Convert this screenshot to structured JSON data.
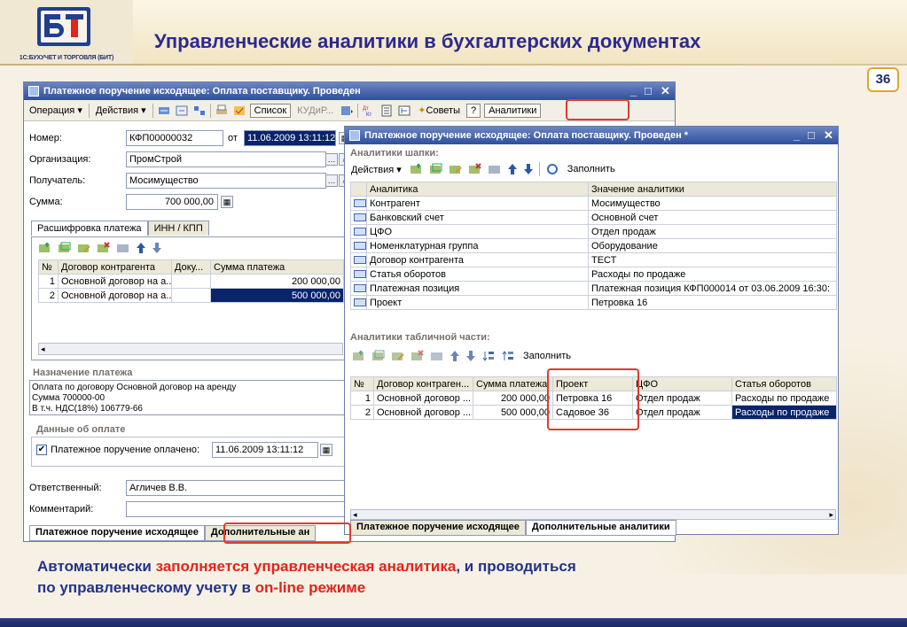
{
  "header": {
    "logo_caption": "1С:БУХУЧЕТ И ТОРГОВЛЯ (БИТ)",
    "title": "Управленческие аналитики в бухгалтерских документах",
    "page_number": "36"
  },
  "win1": {
    "title": "Платежное поручение исходящее: Оплата поставщику. Проведен",
    "toolbar": {
      "operation": "Операция ▾",
      "actions": "Действия ▾",
      "list": "Список",
      "kud": "КУДиР...",
      "advice": "Советы",
      "help": "?",
      "analytics": "Аналитики"
    },
    "form": {
      "number_label": "Номер:",
      "number_value": "КФП00000032",
      "from_label": "от",
      "date_value": "11.06.2009 13:11:12",
      "org_label": "Организация:",
      "org_value": "ПромСтрой",
      "recipient_label": "Получатель:",
      "recipient_value": "Мосимущество",
      "sum_label": "Сумма:",
      "sum_value": "700 000,00"
    },
    "tabs": [
      "Расшифровка платежа",
      "ИНН / КПП"
    ],
    "table": {
      "headers": [
        "№",
        "Договор контрагента",
        "Доку...",
        "Сумма платежа"
      ],
      "rows": [
        {
          "n": "1",
          "contract": "Основной договор на а...",
          "doc": "",
          "sum": "200 000,00"
        },
        {
          "n": "2",
          "contract": "Основной договор на а...",
          "doc": "",
          "sum": "500 000,00"
        }
      ]
    },
    "purpose_title": "Назначение платежа",
    "purpose_lines": [
      "Оплата по договору Основной договор на аренду",
      "Сумма 700000-00",
      "В т.ч. НДС(18%) 106779-66"
    ],
    "payment_group": "Данные об оплате",
    "paid_checkbox": "Платежное поручение оплачено:",
    "paid_date": "11.06.2009 13:11:12",
    "responsible_label": "Ответственный:",
    "responsible_value": "Агличев В.В.",
    "comment_label": "Комментарий:",
    "bottom_tabs": [
      "Платежное поручение исходящее",
      "Дополнительные ан"
    ]
  },
  "win2": {
    "title": "Платежное поручение исходящее: Оплата поставщику. Проведен *",
    "header_section": "Аналитики шапки:",
    "actions": "Действия ▾",
    "fill": "Заполнить",
    "header_table": {
      "headers": [
        "Аналитика",
        "Значение аналитики"
      ],
      "rows": [
        {
          "name": "Контрагент",
          "value": "Мосимущество"
        },
        {
          "name": "Банковский счет",
          "value": "Основной счет"
        },
        {
          "name": "ЦФО",
          "value": "Отдел продаж"
        },
        {
          "name": "Номенклатурная группа",
          "value": "Оборудование"
        },
        {
          "name": "Договор контрагента",
          "value": "ТЕСТ"
        },
        {
          "name": "Статья оборотов",
          "value": "Расходы по продаже"
        },
        {
          "name": "Платежная позиция",
          "value": "Платежная позиция КФП000014 от 03.06.2009 16:30:"
        },
        {
          "name": "Проект",
          "value": "Петровка 16"
        }
      ]
    },
    "table_section": "Аналитики табличной части:",
    "fill2": "Заполнить",
    "detail_table": {
      "headers": [
        "№",
        "Договор контраген...",
        "Сумма платежа",
        "Проект",
        "ЦФО",
        "Статья оборотов"
      ],
      "rows": [
        {
          "n": "1",
          "contract": "Основной договор ...",
          "sum": "200 000,00",
          "project": "Петровка 16",
          "cfo": "Отдел продаж",
          "item": "Расходы по продаже"
        },
        {
          "n": "2",
          "contract": "Основной договор ...",
          "sum": "500 000,00",
          "project": "Садовое 36",
          "cfo": "Отдел продаж",
          "item": "Расходы по продаже"
        }
      ]
    },
    "bottom_tabs": [
      "Платежное поручение исходящее",
      "Дополнительные аналитики"
    ]
  },
  "caption": {
    "p1": "Автоматически ",
    "p2": "заполняется управленческая аналитика",
    "p3": ", и проводиться",
    "p4": "по управленческому учету в ",
    "p5": "on-line режиме"
  },
  "colors": {
    "title": "#2b2a8c",
    "highlight": "#e2241c",
    "window_title": "#2f4f9c"
  }
}
